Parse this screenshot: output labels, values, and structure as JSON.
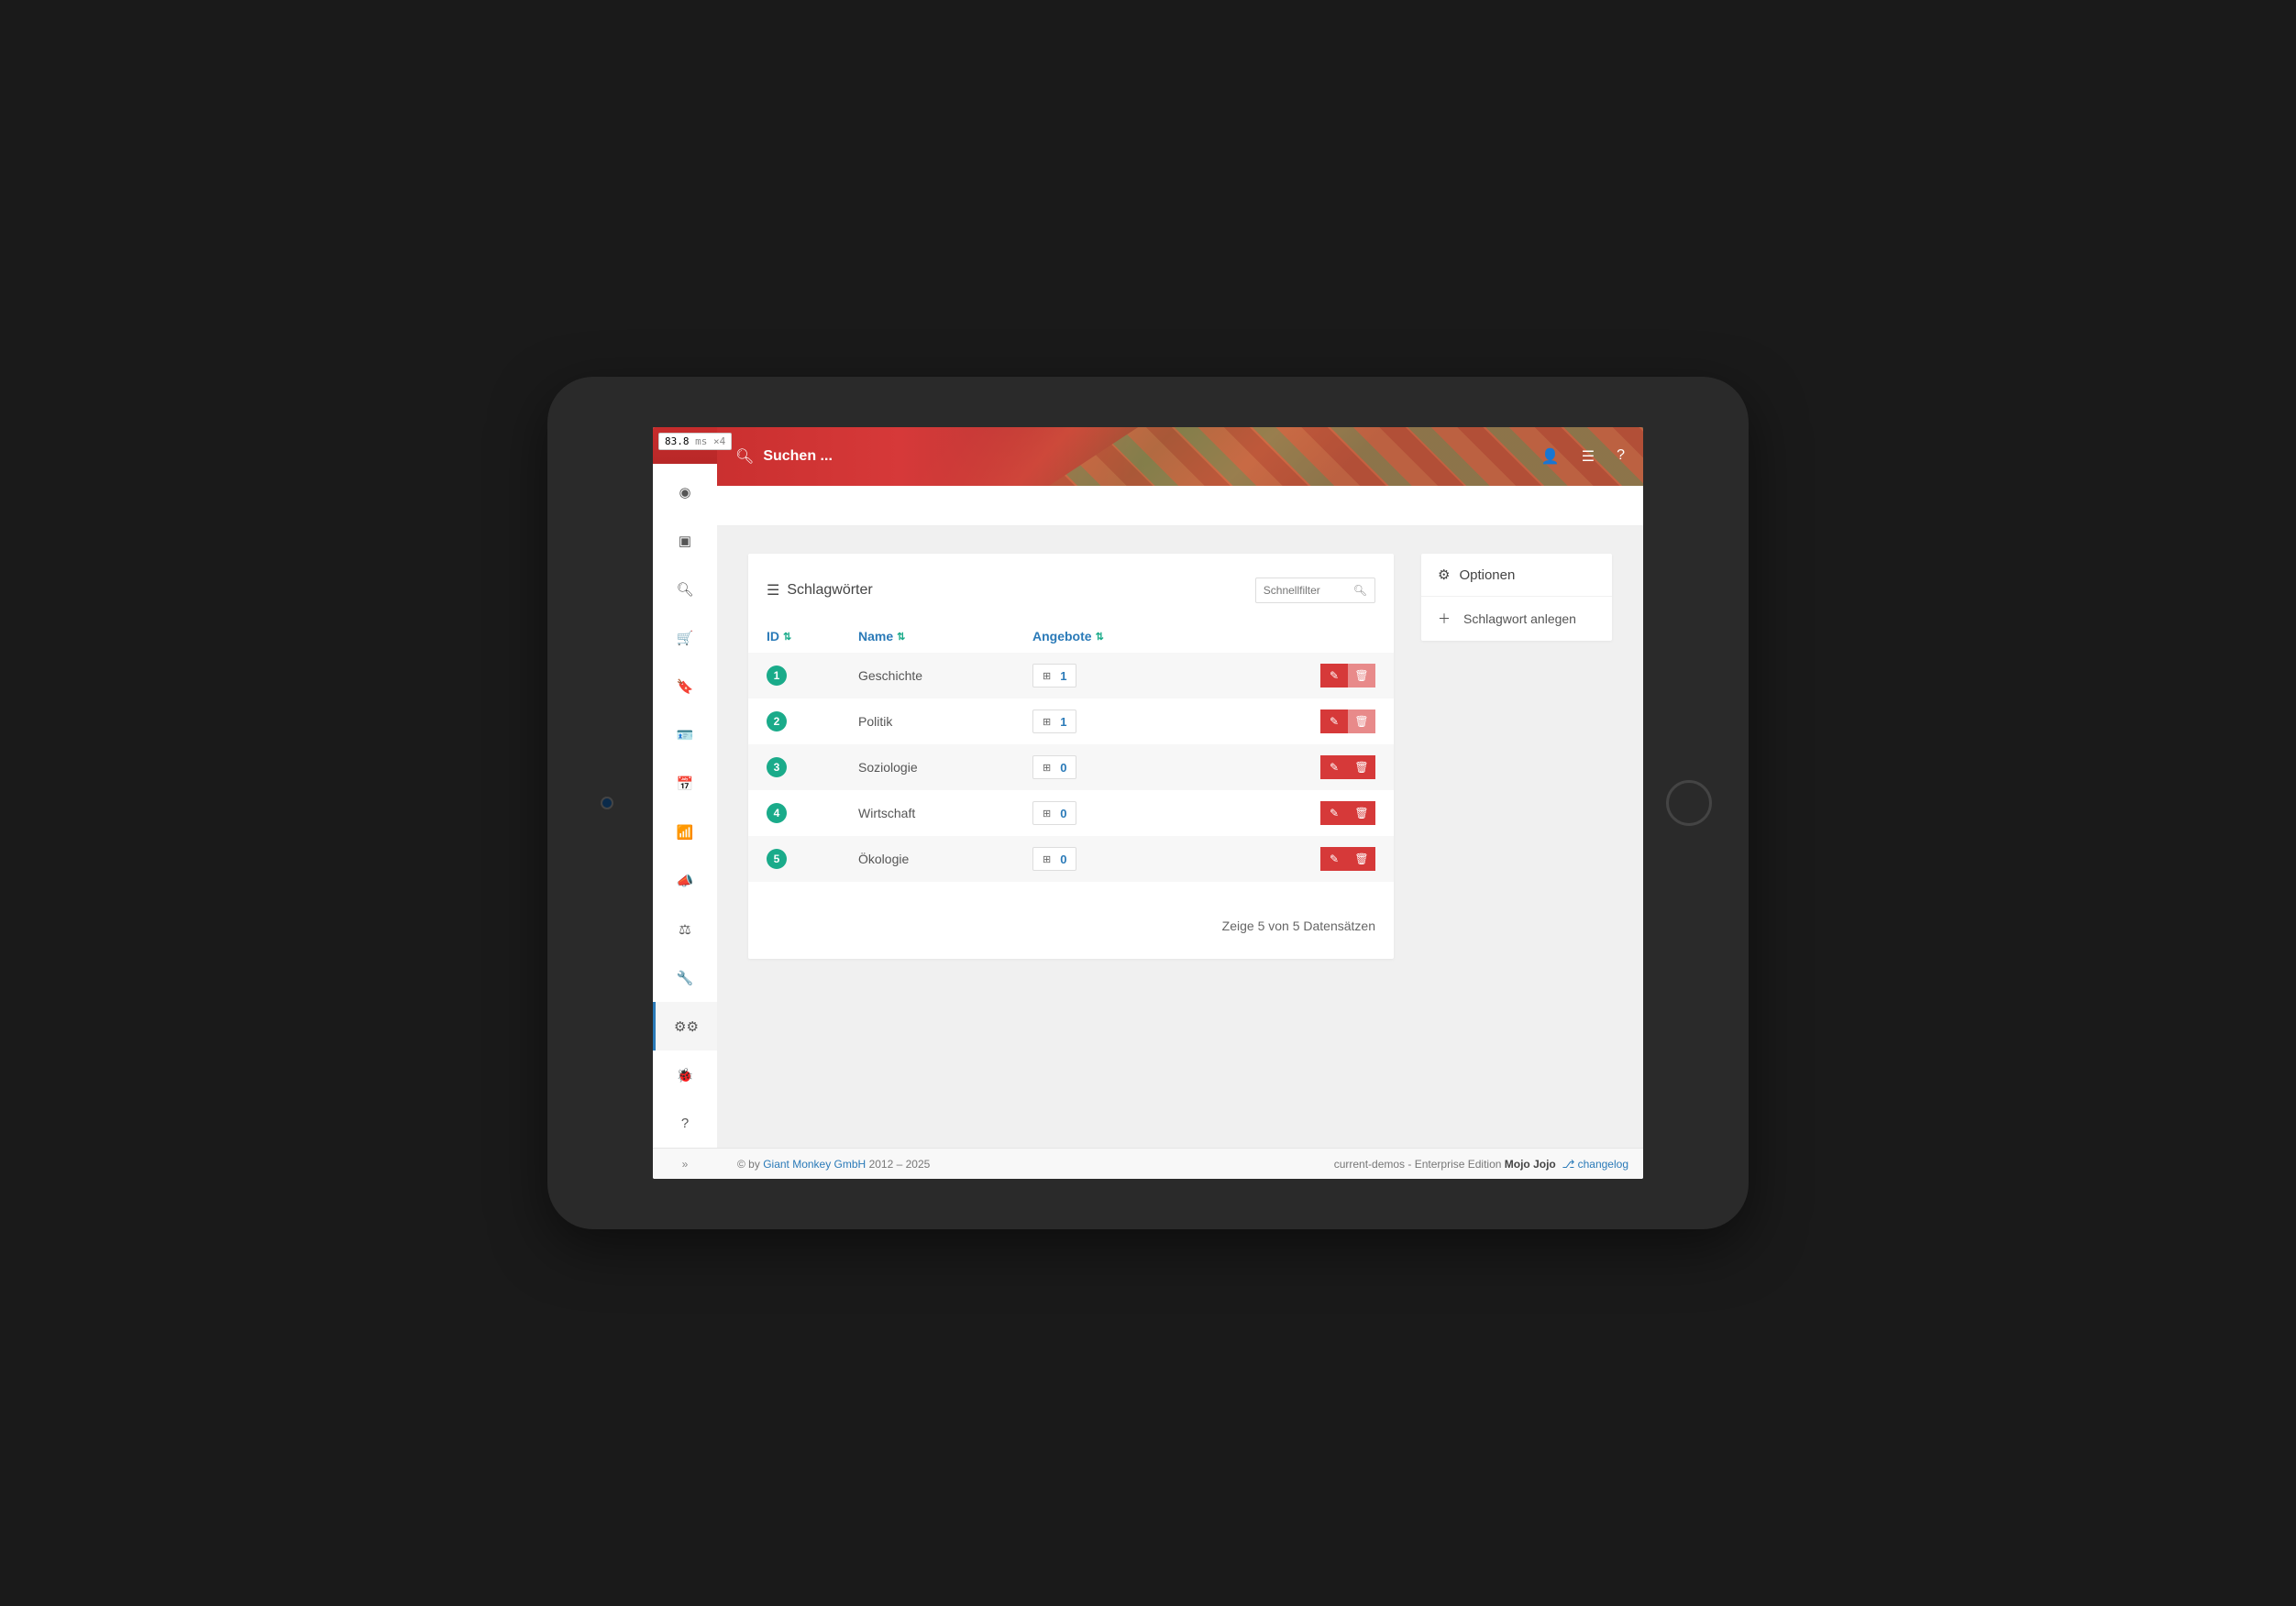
{
  "perf": {
    "time": "83.8",
    "unit": "ms",
    "mult": "×4"
  },
  "header": {
    "search_placeholder": "Suchen ..."
  },
  "sidebar": {
    "items": [
      {
        "icon": "dashboard-icon"
      },
      {
        "icon": "inbox-icon"
      },
      {
        "icon": "search-icon"
      },
      {
        "icon": "cart-icon"
      },
      {
        "icon": "bookmark-icon"
      },
      {
        "icon": "id-card-icon"
      },
      {
        "icon": "calendar-check-icon"
      },
      {
        "icon": "stats-icon"
      },
      {
        "icon": "megaphone-icon"
      },
      {
        "icon": "gavel-icon"
      },
      {
        "icon": "wrench-icon"
      },
      {
        "icon": "cogs-icon",
        "active": true
      },
      {
        "icon": "bug-icon"
      },
      {
        "icon": "question-icon"
      }
    ]
  },
  "main": {
    "title": "Schlagwörter",
    "quickfilter_placeholder": "Schnellfilter",
    "columns": {
      "id": "ID",
      "name": "Name",
      "angebote": "Angebote"
    },
    "rows": [
      {
        "id": "1",
        "name": "Geschichte",
        "count": "1",
        "delete_disabled": true
      },
      {
        "id": "2",
        "name": "Politik",
        "count": "1",
        "delete_disabled": true
      },
      {
        "id": "3",
        "name": "Soziologie",
        "count": "0",
        "delete_disabled": false
      },
      {
        "id": "4",
        "name": "Wirtschaft",
        "count": "0",
        "delete_disabled": false
      },
      {
        "id": "5",
        "name": "Ökologie",
        "count": "0",
        "delete_disabled": false
      }
    ],
    "footer": "Zeige 5 von 5 Datensätzen"
  },
  "options": {
    "title": "Optionen",
    "create": "Schlagwort anlegen"
  },
  "footer": {
    "copy_prefix": "© by ",
    "company": "Giant Monkey GmbH",
    "years": " 2012 – 2025",
    "right_text": "current-demos - Enterprise Edition ",
    "user": "Mojo Jojo",
    "changelog": "changelog"
  }
}
